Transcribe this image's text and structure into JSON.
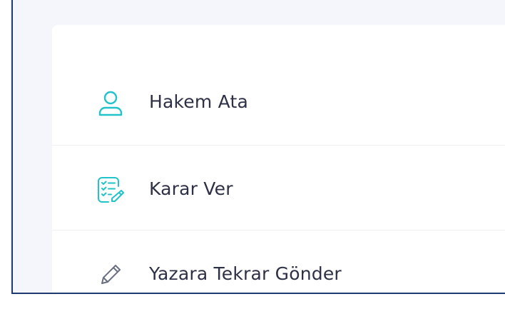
{
  "menu": {
    "items": [
      {
        "label": "Hakem Ata",
        "icon": "user-icon",
        "icon_color": "#22c3c9"
      },
      {
        "label": "Karar Ver",
        "icon": "checklist-edit-icon",
        "icon_color": "#22c3c9"
      },
      {
        "label": "Yazara Tekrar Gönder",
        "icon": "pencil-icon",
        "icon_color": "#6b7080"
      }
    ]
  }
}
